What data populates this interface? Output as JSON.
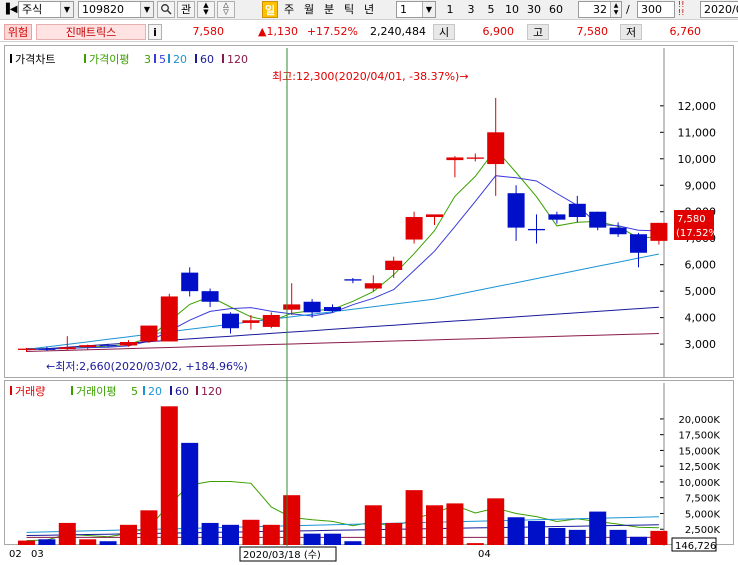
{
  "toolbar": {
    "market": "주식",
    "code": "109820",
    "btn_related": "관",
    "period_selected": "일",
    "periods": [
      "주",
      "월",
      "분",
      "틱",
      "년"
    ],
    "interval_value": "1",
    "intervals": [
      "1",
      "3",
      "5",
      "10",
      "30",
      "60"
    ],
    "count_value": "32",
    "count_total": "300",
    "date_value": "2020/0"
  },
  "quote": {
    "warning": "위험",
    "name": "진매트릭스",
    "info_btn": "i",
    "price": "7,580",
    "change": "▲1,130",
    "change_pct": "+17.52%",
    "volume": "2,240,484",
    "open_label": "시",
    "open": "6,900",
    "high_label": "고",
    "high": "7,580",
    "low_label": "저",
    "low": "6,760"
  },
  "price_panel": {
    "legend_title": "가격차트",
    "legend_ma_title": "가격이평",
    "legend_items": [
      "3",
      "5",
      "20",
      "60",
      "120"
    ],
    "high_note": "최고:12,300(2020/04/01, -38.37%)→",
    "low_note": "←최저:2,660(2020/03/02, +184.96%)",
    "last_price_tag": "7,580",
    "last_change_tag": "(17.52%)",
    "y_ticks": [
      "12,000",
      "11,000",
      "10,000",
      "9,000",
      "8,000",
      "7,000",
      "6,000",
      "5,000",
      "4,000",
      "3,000"
    ]
  },
  "volume_panel": {
    "legend_title": "거래량",
    "legend_ma_title": "거래이평",
    "legend_items": [
      "5",
      "20",
      "60",
      "120"
    ],
    "y_ticks": [
      "20,000K",
      "17,500K",
      "15,000K",
      "12,500K",
      "10,000K",
      "7,500K",
      "5,000K",
      "2,500K"
    ],
    "last_volume_tag": "146,726"
  },
  "x_axis": {
    "labels": [
      "02",
      "03",
      "04"
    ],
    "crosshair_date": "2020/03/18 (수)"
  },
  "colors": {
    "up": "#e00000",
    "down": "#0010c8",
    "ma3": "#3aa000",
    "ma5": "#3a3adc",
    "ma20": "#1c94d4",
    "ma60": "#1a1a9a",
    "ma120": "#8a1a4a",
    "crosshair": "#2e8b2e"
  },
  "chart_data": {
    "type": "candlestick",
    "candles": [
      {
        "o": 2780,
        "h": 2860,
        "l": 2700,
        "c": 2830,
        "v": 700
      },
      {
        "o": 2820,
        "h": 2900,
        "l": 2740,
        "c": 2810,
        "v": 900
      },
      {
        "o": 2810,
        "h": 3300,
        "l": 2760,
        "c": 2880,
        "v": 3500
      },
      {
        "o": 2890,
        "h": 2980,
        "l": 2800,
        "c": 2960,
        "v": 900
      },
      {
        "o": 2960,
        "h": 3010,
        "l": 2900,
        "c": 2930,
        "v": 600
      },
      {
        "o": 2950,
        "h": 3150,
        "l": 2900,
        "c": 3080,
        "v": 3200
      },
      {
        "o": 3100,
        "h": 3700,
        "l": 3050,
        "c": 3700,
        "v": 5500
      },
      {
        "o": 3100,
        "h": 4900,
        "l": 3100,
        "c": 4800,
        "v": 22000
      },
      {
        "o": 5700,
        "h": 5900,
        "l": 4800,
        "c": 5000,
        "v": 16200
      },
      {
        "o": 5000,
        "h": 5100,
        "l": 4400,
        "c": 4600,
        "v": 3500
      },
      {
        "o": 4150,
        "h": 4200,
        "l": 3400,
        "c": 3600,
        "v": 3200
      },
      {
        "o": 3800,
        "h": 4100,
        "l": 3550,
        "c": 3900,
        "v": 4000
      },
      {
        "o": 3650,
        "h": 4200,
        "l": 3600,
        "c": 4100,
        "v": 3200
      },
      {
        "o": 4300,
        "h": 5300,
        "l": 4100,
        "c": 4500,
        "v": 7900
      },
      {
        "o": 4600,
        "h": 4700,
        "l": 4000,
        "c": 4200,
        "v": 1800
      },
      {
        "o": 4400,
        "h": 4500,
        "l": 4200,
        "c": 4250,
        "v": 1800
      },
      {
        "o": 5450,
        "h": 5500,
        "l": 5300,
        "c": 5400,
        "v": 600
      },
      {
        "o": 5100,
        "h": 5600,
        "l": 5000,
        "c": 5300,
        "v": 6300
      },
      {
        "o": 5800,
        "h": 6300,
        "l": 5500,
        "c": 6150,
        "v": 3500
      },
      {
        "o": 6950,
        "h": 8000,
        "l": 6800,
        "c": 7800,
        "v": 8700
      },
      {
        "o": 7800,
        "h": 7850,
        "l": 7500,
        "c": 7900,
        "v": 6300
      },
      {
        "o": 9950,
        "h": 10100,
        "l": 9300,
        "c": 10050,
        "v": 6600
      },
      {
        "o": 10000,
        "h": 10200,
        "l": 9900,
        "c": 10050,
        "v": 300
      },
      {
        "o": 9800,
        "h": 12300,
        "l": 8600,
        "c": 11000,
        "v": 7400
      },
      {
        "o": 8700,
        "h": 9000,
        "l": 6900,
        "c": 7400,
        "v": 4400
      },
      {
        "o": 7350,
        "h": 7900,
        "l": 6800,
        "c": 7300,
        "v": 3800
      },
      {
        "o": 7900,
        "h": 8000,
        "l": 7550,
        "c": 7700,
        "v": 2700
      },
      {
        "o": 8300,
        "h": 8600,
        "l": 7600,
        "c": 7800,
        "v": 2400
      },
      {
        "o": 8000,
        "h": 8000,
        "l": 7300,
        "c": 7400,
        "v": 5300
      },
      {
        "o": 7400,
        "h": 7600,
        "l": 7050,
        "c": 7150,
        "v": 2400
      },
      {
        "o": 7150,
        "h": 7200,
        "l": 5900,
        "c": 6450,
        "v": 1300
      },
      {
        "o": 6900,
        "h": 7580,
        "l": 6760,
        "c": 7580,
        "v": 2240
      }
    ],
    "ylim": [
      2400,
      12900
    ],
    "vol_max": 23000
  }
}
